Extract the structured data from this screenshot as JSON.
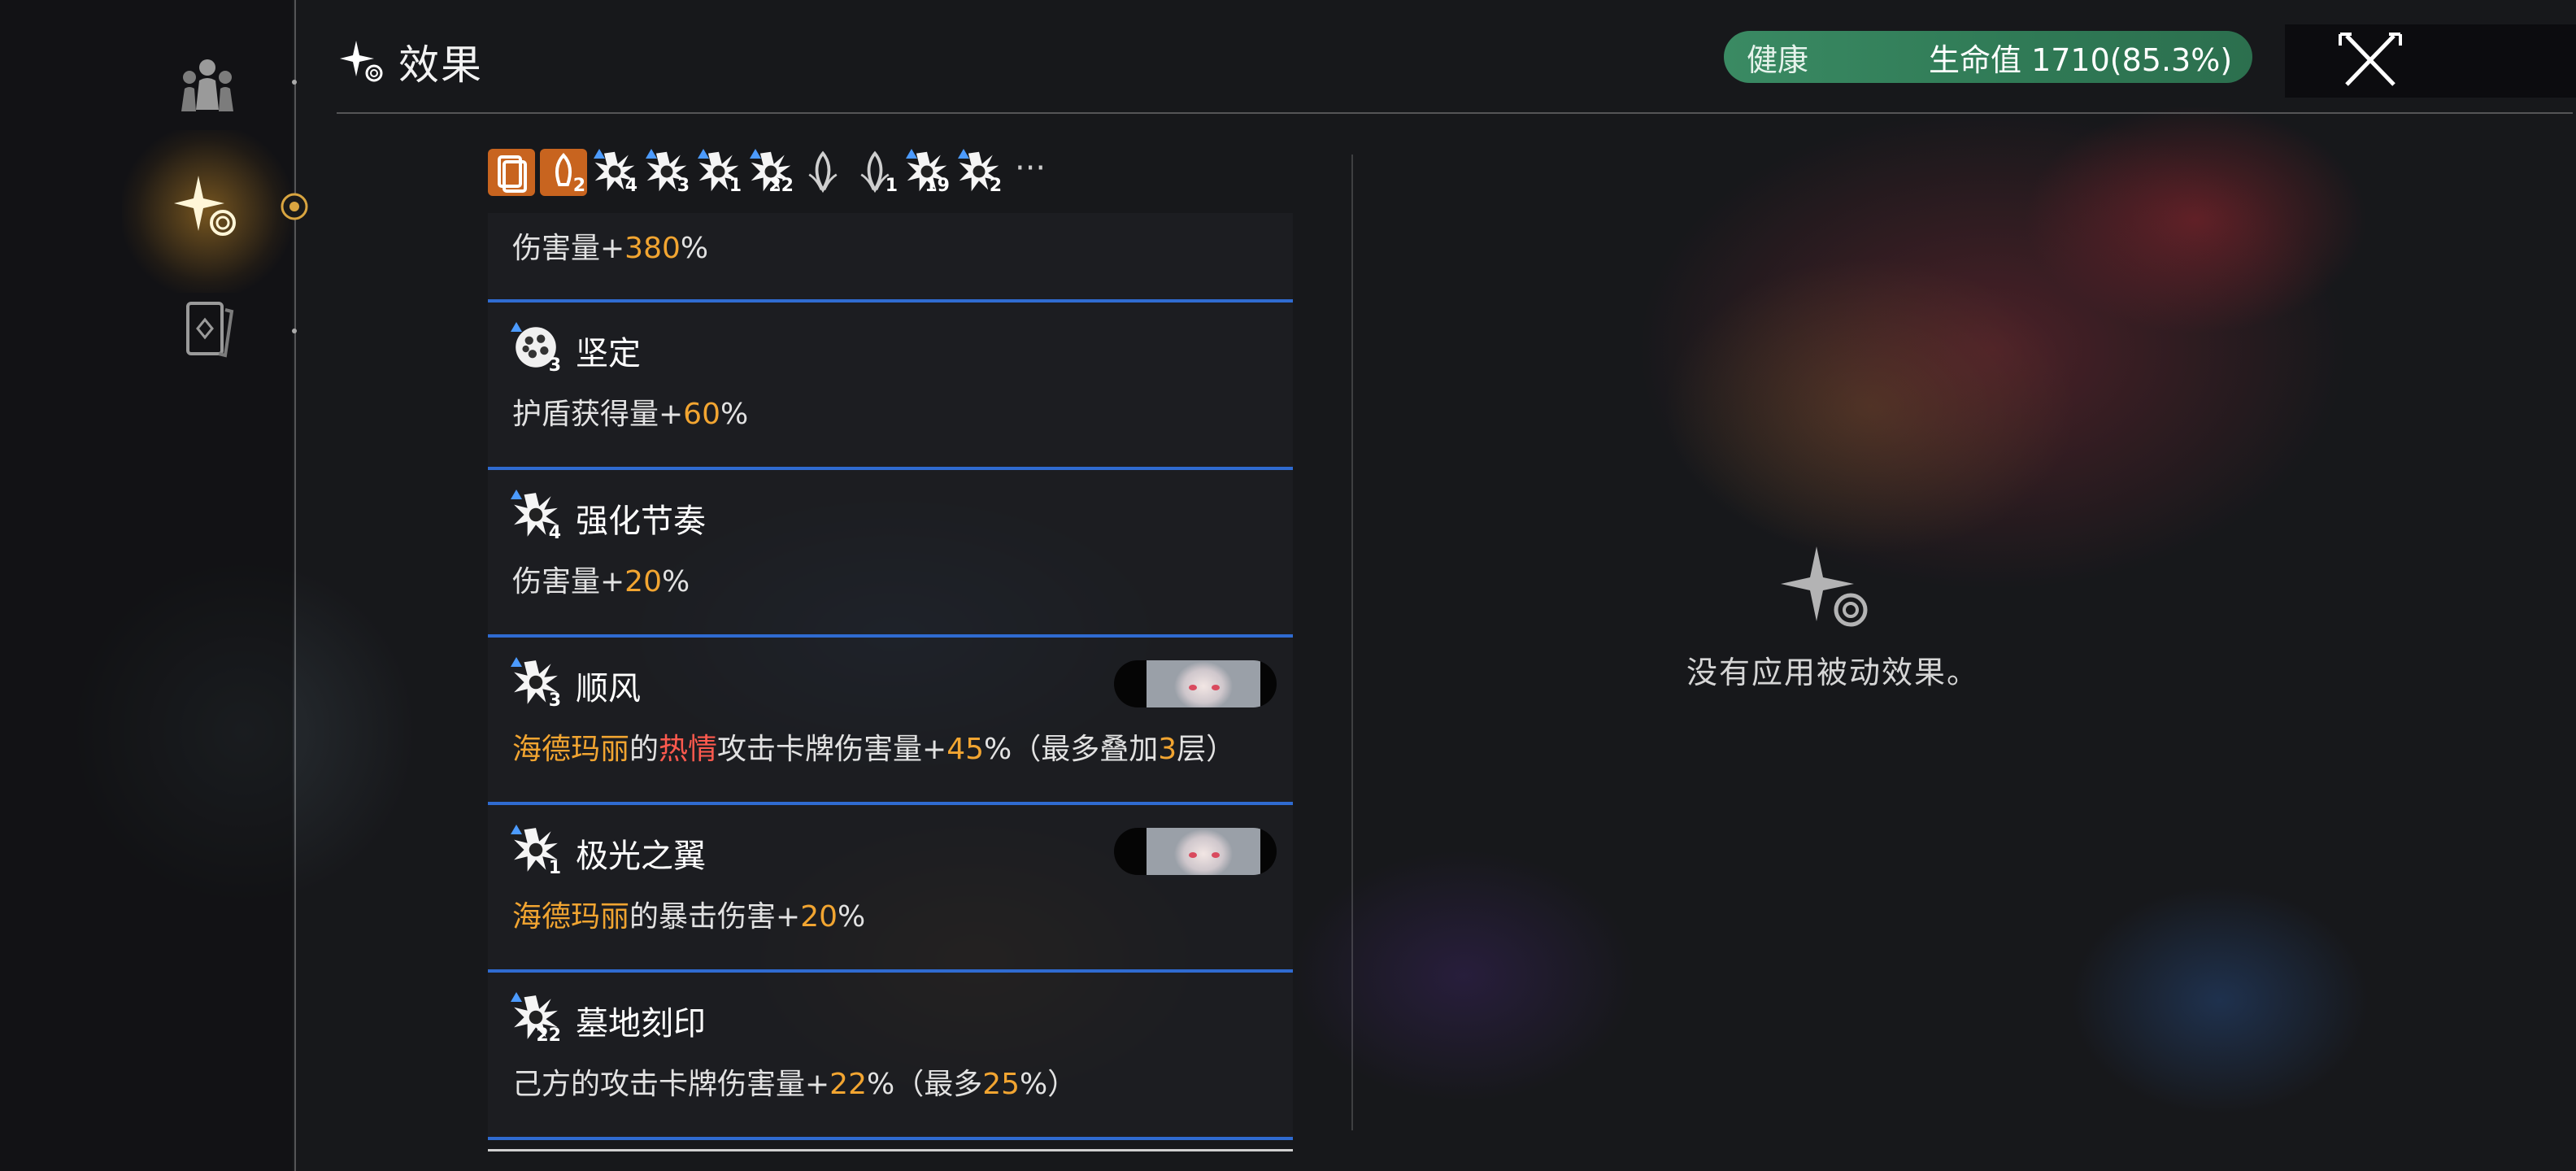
{
  "header": {
    "title": "效果",
    "health_label": "健康",
    "health_value": "生命值 1710(85.3%)"
  },
  "colors": {
    "highlight_number": "#f2a531",
    "highlight_keyword": "#ff5a4e",
    "separator": "#2f6bd1",
    "health_bar": "#3a8a63"
  },
  "sidebar": {
    "items": [
      {
        "icon": "characters-icon",
        "active": false
      },
      {
        "icon": "effects-sparkle-icon",
        "active": true
      },
      {
        "icon": "cards-icon",
        "active": false
      }
    ]
  },
  "icon_bar": {
    "items": [
      {
        "icon": "card-stack-icon",
        "count": ""
      },
      {
        "icon": "relic-icon",
        "count": "2"
      },
      {
        "icon": "rhythm-burst-icon",
        "count": "4"
      },
      {
        "icon": "wind-burst-icon",
        "count": "3"
      },
      {
        "icon": "aurora-wing-icon",
        "count": "1"
      },
      {
        "icon": "grave-mark-icon",
        "count": "22"
      },
      {
        "icon": "leaf-icon",
        "count": ""
      },
      {
        "icon": "leaf-rank-icon",
        "count": "1"
      },
      {
        "icon": "fist-icon",
        "count": "19"
      },
      {
        "icon": "burst-icon",
        "count": "2"
      }
    ],
    "more": "···"
  },
  "effects": [
    {
      "title": "",
      "count": "",
      "desc": [
        {
          "t": "伤害量+"
        },
        {
          "t": "380",
          "c": "o"
        },
        {
          "t": "%"
        }
      ]
    },
    {
      "title": "坚定",
      "count": "3",
      "icon": "shield-cluster-icon",
      "desc": [
        {
          "t": "护盾获得量+"
        },
        {
          "t": "60",
          "c": "o"
        },
        {
          "t": "%"
        }
      ]
    },
    {
      "title": "强化节奏",
      "count": "4",
      "icon": "rhythm-burst-icon",
      "desc": [
        {
          "t": "伤害量+"
        },
        {
          "t": "20",
          "c": "o"
        },
        {
          "t": "%"
        }
      ]
    },
    {
      "title": "顺风",
      "count": "3",
      "icon": "wind-burst-icon",
      "portrait": true,
      "desc": [
        {
          "t": "海德玛丽",
          "c": "o"
        },
        {
          "t": "的"
        },
        {
          "t": "热情",
          "c": "r"
        },
        {
          "t": "攻击卡牌伤害量+"
        },
        {
          "t": "45",
          "c": "o"
        },
        {
          "t": "%（最多叠加"
        },
        {
          "t": "3",
          "c": "o"
        },
        {
          "t": "层）"
        }
      ]
    },
    {
      "title": "极光之翼",
      "count": "1",
      "icon": "aurora-wing-icon",
      "portrait": true,
      "desc": [
        {
          "t": "海德玛丽",
          "c": "o"
        },
        {
          "t": "的暴击伤害+"
        },
        {
          "t": "20",
          "c": "o"
        },
        {
          "t": "%"
        }
      ]
    },
    {
      "title": "墓地刻印",
      "count": "22",
      "icon": "grave-mark-icon",
      "desc": [
        {
          "t": "己方的攻击卡牌伤害量+"
        },
        {
          "t": "22",
          "c": "o"
        },
        {
          "t": "%（最多"
        },
        {
          "t": "25",
          "c": "o"
        },
        {
          "t": "%）"
        }
      ]
    }
  ],
  "passive": {
    "empty_text": "没有应用被动效果。"
  }
}
